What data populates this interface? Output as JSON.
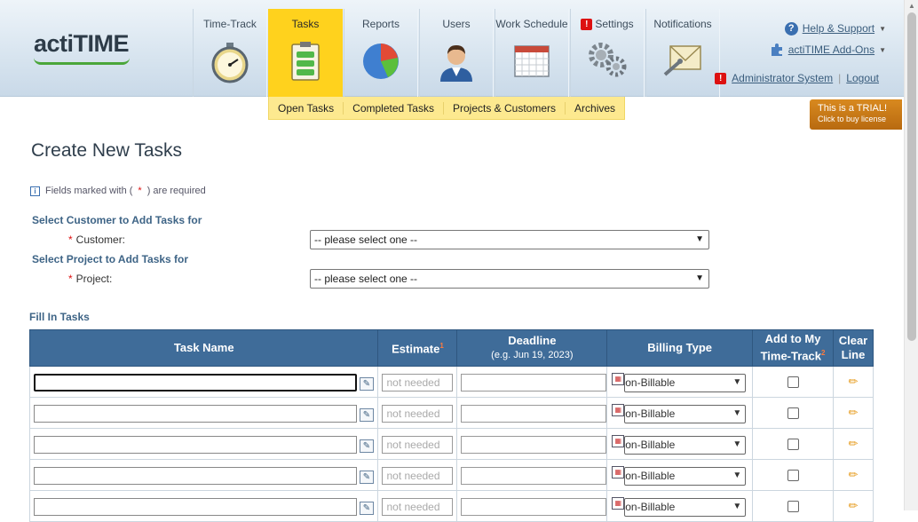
{
  "logo": "actiTIME",
  "nav": [
    {
      "label": "Time-Track",
      "icon": "stopwatch-icon"
    },
    {
      "label": "Tasks",
      "icon": "tasks-icon"
    },
    {
      "label": "Reports",
      "icon": "pie-chart-icon"
    },
    {
      "label": "Users",
      "icon": "user-icon"
    },
    {
      "label": "Work Schedule",
      "icon": "calendar-icon"
    },
    {
      "label": "Settings",
      "icon": "gears-icon"
    },
    {
      "label": "Notifications",
      "icon": "envelope-icon"
    }
  ],
  "header_right": {
    "help": "Help & Support",
    "addons": "actiTIME Add-Ons",
    "admin": "Administrator System",
    "logout": "Logout"
  },
  "subnav": [
    "Open Tasks",
    "Completed Tasks",
    "Projects & Customers",
    "Archives"
  ],
  "trial": {
    "line1": "This is a TRIAL!",
    "line2": "Click to buy license"
  },
  "page": {
    "title": "Create New Tasks",
    "required_prefix": "Fields marked with (",
    "required_star": "*",
    "required_suffix": ") are required",
    "customer_section": "Select Customer to Add Tasks for",
    "customer_label": "Customer:",
    "customer_value": "-- please select one --",
    "project_section": "Select Project to Add Tasks for",
    "project_label": "Project:",
    "project_value": "-- please select one --",
    "fill_section": "Fill In Tasks"
  },
  "table": {
    "headers": {
      "task_name": "Task Name",
      "estimate": "Estimate",
      "estimate_sup": "1",
      "deadline": "Deadline",
      "deadline_sub": "(e.g. Jun 19, 2023)",
      "billing": "Billing Type",
      "add_my": "Add to My",
      "add_my_2": "Time-Track",
      "add_my_sup": "2",
      "clear": "Clear",
      "clear_2": "Line"
    },
    "rows": [
      {
        "estimate_placeholder": "not needed",
        "billing": "on-Billable"
      },
      {
        "estimate_placeholder": "not needed",
        "billing": "on-Billable"
      },
      {
        "estimate_placeholder": "not needed",
        "billing": "on-Billable"
      },
      {
        "estimate_placeholder": "not needed",
        "billing": "on-Billable"
      },
      {
        "estimate_placeholder": "not needed",
        "billing": "on-Billable"
      }
    ]
  }
}
